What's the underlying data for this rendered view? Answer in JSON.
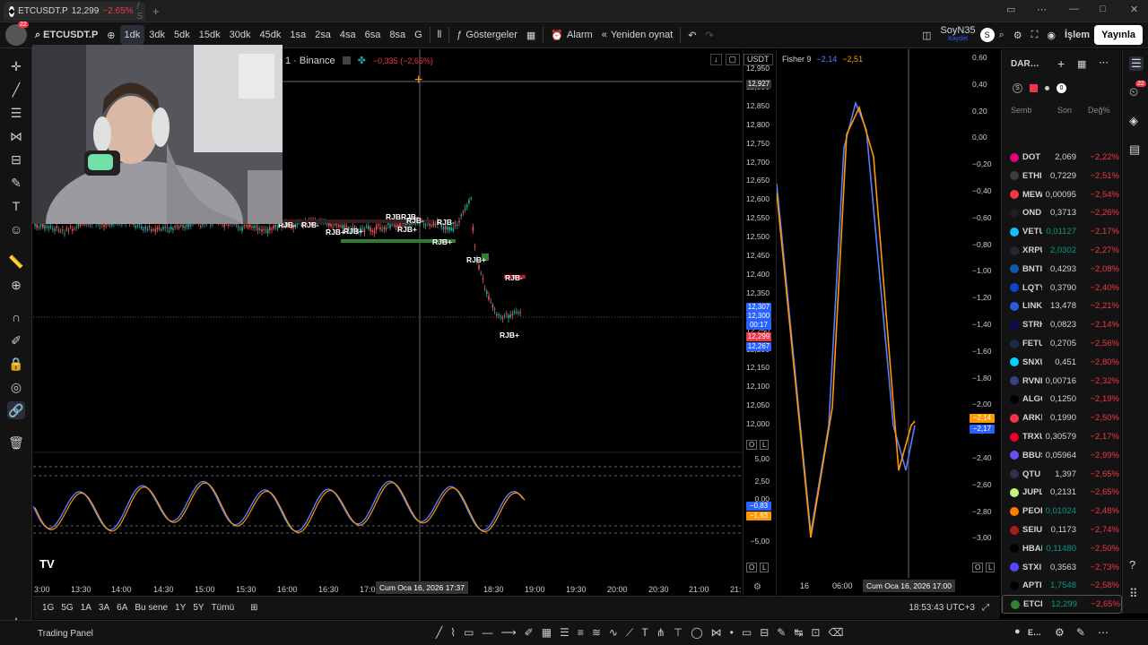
{
  "tab": {
    "title": "ETCUSDT.P",
    "price": "12,299",
    "change": "−2.65%",
    "suffix": "/ S"
  },
  "window": {
    "min": "—",
    "max": "□",
    "close": "✕"
  },
  "toolbar": {
    "symbol": "ETCUSDT.P",
    "intervals": [
      "1dk",
      "3dk",
      "5dk",
      "15dk",
      "30dk",
      "45dk",
      "1sa",
      "2sa",
      "4sa",
      "6sa",
      "8sa",
      "G"
    ],
    "active_interval": "1dk",
    "indicators_label": "Göstergeler",
    "alarm_label": "Alarm",
    "replay_label": "Yeniden oynat",
    "layout_name": "SoyN35",
    "layout_sub": "Kaydet",
    "publish_label": "Yayınla",
    "trade_label": "İşlem"
  },
  "legend": {
    "exchange": "1 · Binance",
    "change": "−0,335 (−2,65%)",
    "currency": "USDT"
  },
  "price_axis": {
    "labels": [
      "12,950",
      "12,900",
      "12,850",
      "12,800",
      "12,750",
      "12,700",
      "12,650",
      "12,600",
      "12,550",
      "12,500",
      "12,450",
      "12,400",
      "12,350",
      "12,300",
      "12,250",
      "12,200",
      "12,150",
      "12,100",
      "12,050",
      "12,000"
    ],
    "crosshair": "12,927",
    "tags": [
      {
        "text": "12,307",
        "color": "#2962ff"
      },
      {
        "text": "12,300",
        "color": "#2962ff"
      },
      {
        "text": "00:17",
        "color": "#2962ff"
      },
      {
        "text": "12,299",
        "color": "#f23645"
      },
      {
        "text": "12,267",
        "color": "#2962ff"
      }
    ]
  },
  "osc_axis": {
    "labels": [
      "5,00",
      "2,50",
      "0,00",
      "−5,00"
    ],
    "tags": [
      "−0,83",
      "−1,63"
    ]
  },
  "time_axis": {
    "labels": [
      "3:00",
      "13:30",
      "14:00",
      "14:30",
      "15:00",
      "15:30",
      "16:00",
      "16:30",
      "17:0",
      "18:30",
      "19:00",
      "19:30",
      "20:00",
      "20:30",
      "21:00",
      "21:"
    ],
    "crosshair": "Cum Oca 16, 2026   17:37"
  },
  "rjb_labels": [
    "RJB-",
    "RJB-",
    "RJB+",
    "RJB+",
    "RJBRJB-",
    "RJB-",
    "RJB+",
    "RJB-",
    "RJB+",
    "RJB+",
    "RJB-",
    "RJB+"
  ],
  "fisher": {
    "title": "Fisher 9",
    "v1": "−2,14",
    "v2": "−2,51",
    "axis": [
      "0,60",
      "0,40",
      "0,20",
      "0,00",
      "−0,20",
      "−0,40",
      "−0,60",
      "−0,80",
      "−1,00",
      "−1,20",
      "−1,40",
      "−1,60",
      "−1,80",
      "−2,00",
      "−2,20",
      "−2,40",
      "−2,60",
      "−2,80",
      "−3,00"
    ],
    "tags": [
      "−2,14",
      "−2,17"
    ],
    "time": [
      "16",
      "06:00",
      "Cum Oca 16, 2026   17:00"
    ]
  },
  "watchlist": {
    "name": "DAR…",
    "headers": [
      "Semb",
      "Son",
      "Değ%"
    ],
    "rows": [
      {
        "sym": "DOT",
        "last": "2,069",
        "chg": "−2,22%",
        "color": "#e6007a",
        "lastc": "#d1d4dc"
      },
      {
        "sym": "ETHI",
        "last": "0,7229",
        "chg": "−2,51%",
        "color": "#3c3c3d",
        "lastc": "#d1d4dc"
      },
      {
        "sym": "MEW",
        "last": "0,00095",
        "chg": "−2,54%",
        "color": "#f23645",
        "lastc": "#d1d4dc"
      },
      {
        "sym": "OND",
        "last": "0,3713",
        "chg": "−2,26%",
        "color": "#1f1f1f",
        "lastc": "#d1d4dc"
      },
      {
        "sym": "VETU",
        "last": "0,01127",
        "chg": "−2,17%",
        "color": "#15bdff",
        "lastc": "#089981"
      },
      {
        "sym": "XRPU",
        "last": "2,0302",
        "chg": "−2,27%",
        "color": "#23292f",
        "lastc": "#089981"
      },
      {
        "sym": "BNTI",
        "last": "0,4293",
        "chg": "−2,08%",
        "color": "#0e5ca8",
        "lastc": "#d1d4dc"
      },
      {
        "sym": "LQTY",
        "last": "0,3790",
        "chg": "−2,40%",
        "color": "#1542cd",
        "lastc": "#d1d4dc"
      },
      {
        "sym": "LINK",
        "last": "13,478",
        "chg": "−2,21%",
        "color": "#2a5ada",
        "lastc": "#d1d4dc"
      },
      {
        "sym": "STRK",
        "last": "0,0823",
        "chg": "−2,14%",
        "color": "#0c0c4f",
        "lastc": "#d1d4dc"
      },
      {
        "sym": "FETU",
        "last": "0,2705",
        "chg": "−2,56%",
        "color": "#1d2b4a",
        "lastc": "#d1d4dc"
      },
      {
        "sym": "SNXU",
        "last": "0,451",
        "chg": "−2,80%",
        "color": "#00d1ff",
        "lastc": "#d1d4dc"
      },
      {
        "sym": "RVNI",
        "last": "0,00716",
        "chg": "−2,32%",
        "color": "#384182",
        "lastc": "#d1d4dc"
      },
      {
        "sym": "ALGO",
        "last": "0,1250",
        "chg": "−2,19%",
        "color": "#000000",
        "lastc": "#d1d4dc"
      },
      {
        "sym": "ARKI",
        "last": "0,1990",
        "chg": "−2,50%",
        "color": "#f23645",
        "lastc": "#d1d4dc"
      },
      {
        "sym": "TRXU",
        "last": "0,30579",
        "chg": "−2,17%",
        "color": "#eb0029",
        "lastc": "#d1d4dc"
      },
      {
        "sym": "BBUS",
        "last": "0,05964",
        "chg": "−2,99%",
        "color": "#6d4df2",
        "lastc": "#d1d4dc"
      },
      {
        "sym": "QTU",
        "last": "1,397",
        "chg": "−2,65%",
        "color": "#2e3148",
        "lastc": "#d1d4dc"
      },
      {
        "sym": "JUPL",
        "last": "0,2131",
        "chg": "−2,65%",
        "color": "#c7f284",
        "lastc": "#d1d4dc"
      },
      {
        "sym": "PEOI",
        "last": "0,01024",
        "chg": "−2,48%",
        "color": "#ff7a00",
        "lastc": "#089981"
      },
      {
        "sym": "SEIU",
        "last": "0,1173",
        "chg": "−2,74%",
        "color": "#9e1f19",
        "lastc": "#d1d4dc"
      },
      {
        "sym": "HBAI",
        "last": "0,11480",
        "chg": "−2,50%",
        "color": "#000000",
        "lastc": "#089981"
      },
      {
        "sym": "STXI",
        "last": "0,3563",
        "chg": "−2,73%",
        "color": "#5546ff",
        "lastc": "#d1d4dc"
      },
      {
        "sym": "APTI",
        "last": "1,7548",
        "chg": "−2,58%",
        "color": "#000000",
        "lastc": "#089981"
      },
      {
        "sym": "ETCI",
        "last": "12,299",
        "chg": "−2,65%",
        "color": "#328332",
        "lastc": "#089981"
      }
    ]
  },
  "bottom": {
    "ranges": [
      "1G",
      "5G",
      "1A",
      "3A",
      "6A",
      "Bu sene",
      "1Y",
      "5Y",
      "Tümü"
    ],
    "clock": "18:53:43 UTC+3",
    "panel": "Trading Panel",
    "right_label": "E…"
  },
  "badge_count": "22"
}
